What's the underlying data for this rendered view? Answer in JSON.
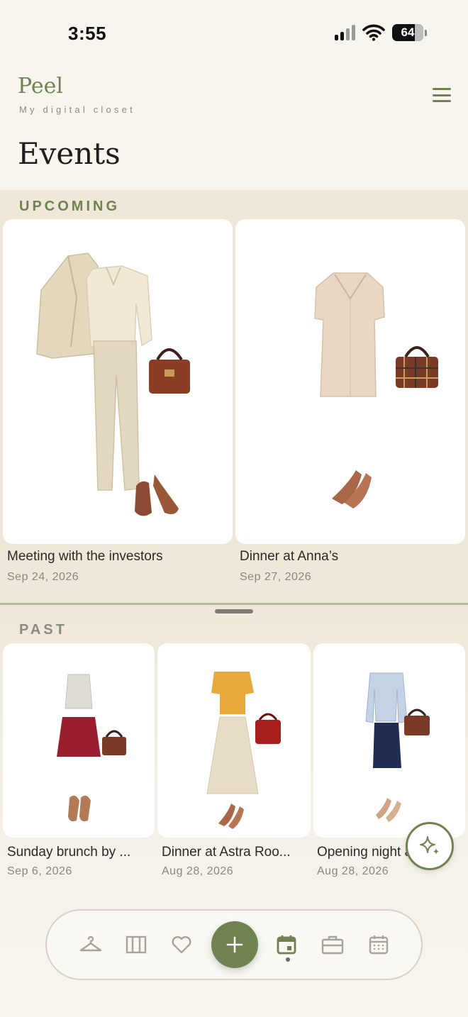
{
  "status_bar": {
    "time": "3:55",
    "battery": "64"
  },
  "header": {
    "brand": "Peel",
    "subtitle": "My digital closet",
    "title": "Events"
  },
  "upcoming": {
    "label": "UPCOMING",
    "events": [
      {
        "name": "Meeting with the investors",
        "date": "Sep 24, 2026"
      },
      {
        "name": "Dinner at Anna’s",
        "date": "Sep 27, 2026"
      }
    ]
  },
  "past": {
    "label": "PAST",
    "events": [
      {
        "name": "Sunday brunch by ...",
        "date": "Sep 6, 2026"
      },
      {
        "name": "Dinner at Astra Roo...",
        "date": "Aug 28, 2026"
      },
      {
        "name": "Opening night at th...",
        "date": "Aug 28, 2026"
      }
    ]
  },
  "nav": {
    "items": [
      "hanger-icon",
      "wardrobe-icon",
      "heart-icon",
      "plus-icon",
      "event-calendar-icon",
      "briefcase-icon",
      "calendar-grid-icon"
    ],
    "active": "event-calendar-icon"
  },
  "colors": {
    "accent": "#6f8250",
    "background": "#f8f5ef",
    "section": "#efe8da"
  }
}
